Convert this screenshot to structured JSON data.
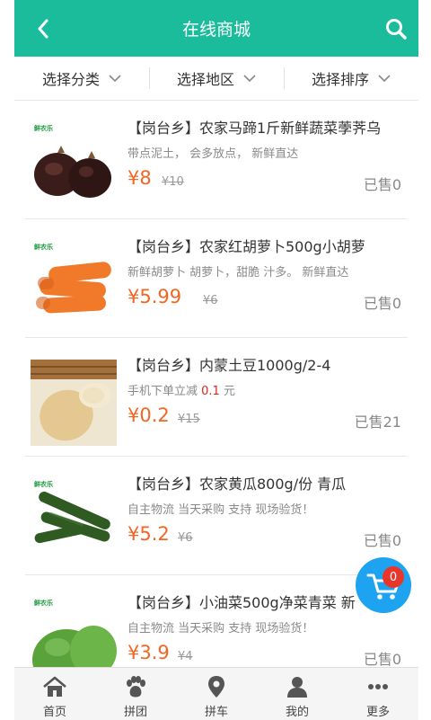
{
  "header": {
    "title": "在线商城",
    "back_icon": "chevron-left-icon",
    "search_icon": "search-icon",
    "color": "#1abc9c"
  },
  "filters": [
    {
      "label": "选择分类"
    },
    {
      "label": "选择地区"
    },
    {
      "label": "选择排序"
    }
  ],
  "products": [
    {
      "name": "【岗台乡】农家马蹄1斤新鲜蔬菜荸荠乌",
      "desc": "带点泥土， 会多放点， 新鲜直达",
      "price": "¥8",
      "orig": "¥10",
      "sold": "已售0",
      "badge": "鲜农乐"
    },
    {
      "name": "【岗台乡】农家红胡萝卜500g小胡萝",
      "desc": "新鲜胡萝卜 胡萝卜，甜脆 汁多。 新鲜直达",
      "price": "¥5.99",
      "orig": "¥6",
      "sold": "已售0",
      "badge": "鲜农乐"
    },
    {
      "name": "【岗台乡】内蒙土豆1000g/2-4",
      "desc_prefix": "手机下单立减",
      "desc_highlight": "0.1",
      "desc_suffix": "元",
      "price": "¥0.2",
      "orig": "¥15",
      "sold": "已售21",
      "badge": ""
    },
    {
      "name": "【岗台乡】农家黄瓜800g/份 青瓜",
      "desc": "自主物流 当天采购 支持 现场验货！",
      "price": "¥5.2",
      "orig": "¥6",
      "sold": "已售0",
      "badge": "鲜农乐"
    },
    {
      "name": "【岗台乡】小油菜500g净菜青菜 新",
      "desc": "自主物流 当天采购 支持 现场验货！",
      "price": "¥3.9",
      "orig": "¥4",
      "sold": "已售0",
      "badge": "鲜农乐"
    }
  ],
  "cart": {
    "count": "0",
    "icon": "cart-icon",
    "color": "#1ea3f0"
  },
  "tabs": [
    {
      "label": "首页",
      "icon": "home-icon"
    },
    {
      "label": "拼团",
      "icon": "paw-icon"
    },
    {
      "label": "拼车",
      "icon": "location-pin-icon"
    },
    {
      "label": "我的",
      "icon": "user-icon"
    },
    {
      "label": "更多",
      "icon": "more-dots-icon"
    }
  ]
}
